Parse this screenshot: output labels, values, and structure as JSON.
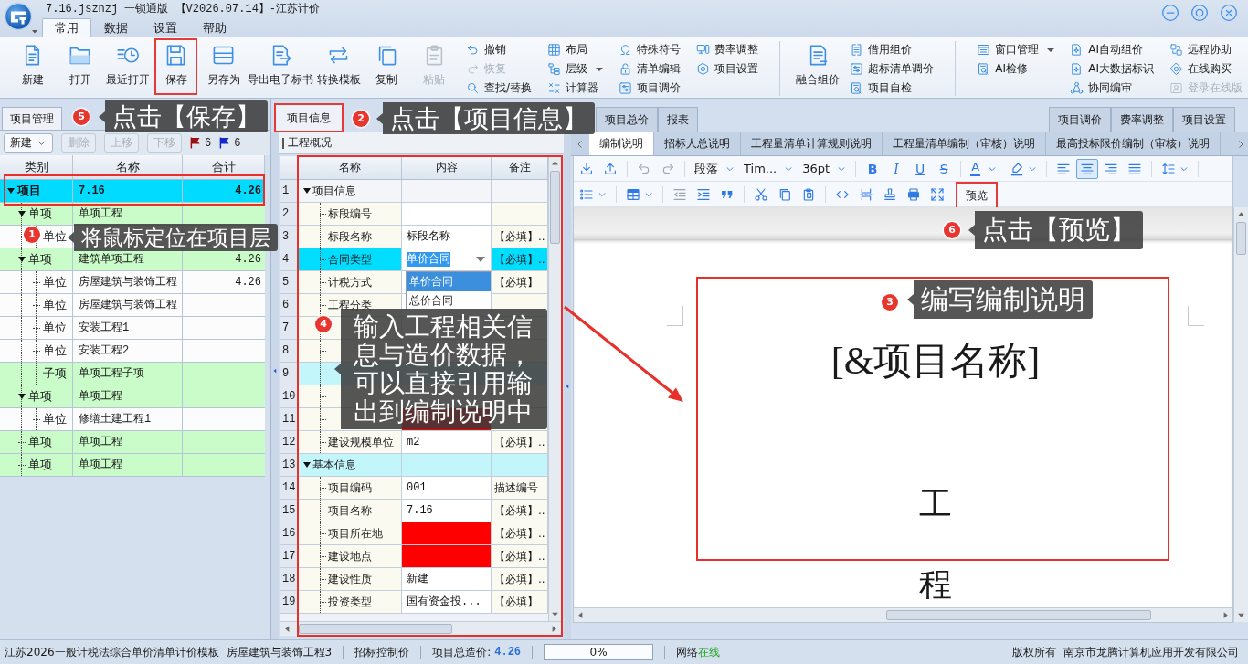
{
  "window": {
    "title": "7.16.jsznzj 一锁通版 【V2026.07.14】-江苏计价"
  },
  "menu_tabs": [
    {
      "label": "常用",
      "selected": true
    },
    {
      "label": "数据",
      "selected": false
    },
    {
      "label": "设置",
      "selected": false
    },
    {
      "label": "帮助",
      "selected": false
    }
  ],
  "ribbon": [
    {
      "kind": "large",
      "label": "新建",
      "disabled": false,
      "marked": false
    },
    {
      "kind": "large",
      "label": "打开",
      "disabled": false,
      "marked": false
    },
    {
      "kind": "large",
      "label": "最近打开",
      "disabled": false,
      "marked": false
    },
    {
      "kind": "large",
      "label": "保存",
      "disabled": false,
      "marked": true
    },
    {
      "kind": "large",
      "label": "另存为",
      "disabled": false,
      "marked": false
    },
    {
      "kind": "large",
      "label": "导出电子标书",
      "disabled": false,
      "marked": false
    },
    {
      "kind": "large",
      "label": "转换模板",
      "disabled": false,
      "marked": false
    },
    {
      "kind": "large",
      "label": "复制",
      "disabled": false,
      "marked": false
    },
    {
      "kind": "large",
      "label": "粘贴",
      "disabled": true,
      "marked": false
    },
    {
      "kind": "stack",
      "buttons": [
        {
          "label": "撤销",
          "disabled": false,
          "has_menu": false
        },
        {
          "label": "恢复",
          "disabled": true,
          "has_menu": false
        },
        {
          "label": "查找/替换",
          "disabled": false,
          "has_menu": false
        }
      ]
    },
    {
      "kind": "stack",
      "buttons": [
        {
          "label": "布局",
          "disabled": false,
          "has_menu": false
        },
        {
          "label": "层级",
          "disabled": false,
          "has_menu": true
        },
        {
          "label": "计算器",
          "disabled": false,
          "has_menu": false
        }
      ]
    },
    {
      "kind": "stack",
      "buttons": [
        {
          "label": "特殊符号",
          "disabled": false,
          "has_menu": false
        },
        {
          "label": "清单编辑",
          "disabled": false,
          "has_menu": false
        },
        {
          "label": "项目调价",
          "disabled": false,
          "has_menu": false
        }
      ]
    },
    {
      "kind": "stack",
      "buttons": [
        {
          "label": "费率调整",
          "disabled": false,
          "has_menu": false
        },
        {
          "label": "项目设置",
          "disabled": false,
          "has_menu": false
        }
      ]
    },
    {
      "kind": "separator"
    },
    {
      "kind": "large",
      "label": "融合组价",
      "disabled": false,
      "marked": false
    },
    {
      "kind": "stack",
      "buttons": [
        {
          "label": "借用组价",
          "disabled": false,
          "has_menu": false
        },
        {
          "label": "超标清单调价",
          "disabled": false,
          "has_menu": false
        },
        {
          "label": "项目自检",
          "disabled": false,
          "has_menu": false
        }
      ]
    },
    {
      "kind": "separator"
    },
    {
      "kind": "stack",
      "buttons": [
        {
          "label": "窗口管理",
          "disabled": false,
          "has_menu": true
        },
        {
          "label": "AI检修",
          "disabled": false,
          "has_menu": false
        }
      ]
    },
    {
      "kind": "stack",
      "buttons": [
        {
          "label": "AI自动组价",
          "disabled": false,
          "has_menu": false
        },
        {
          "label": "AI大数据标识",
          "disabled": false,
          "has_menu": false
        },
        {
          "label": "协同编审",
          "disabled": false,
          "has_menu": false
        }
      ]
    },
    {
      "kind": "stack",
      "buttons": [
        {
          "label": "远程协助",
          "disabled": false,
          "has_menu": false
        },
        {
          "label": "在线购买",
          "disabled": false,
          "has_menu": false
        },
        {
          "label": "登录在线版",
          "disabled": true,
          "has_menu": false
        }
      ]
    }
  ],
  "project_panel": {
    "tab": "项目管理",
    "toolbar": [
      {
        "label": "新建",
        "disabled": false,
        "has_menu": true
      },
      {
        "label": "删除",
        "disabled": true,
        "has_menu": false
      },
      {
        "label": "上移",
        "disabled": true,
        "has_menu": false
      },
      {
        "label": "下移",
        "disabled": true,
        "has_menu": false
      }
    ],
    "flags": [
      {
        "count": "6",
        "color": "#9c1010"
      },
      {
        "count": "6",
        "color": "#1428c8"
      }
    ],
    "columns": [
      "类别",
      "名称",
      "合计"
    ],
    "tree": [
      {
        "kind": "project",
        "category": "项目",
        "name": "7.16",
        "total": "4.26",
        "selected": true,
        "expanded": true,
        "marked": true,
        "children": [
          {
            "kind": "item",
            "category": "单项",
            "name": "单项工程",
            "selected": false,
            "expanded": true,
            "children": [
              {
                "kind": "unit",
                "category": "单位",
                "selected": false,
                "expanded": false
              }
            ]
          },
          {
            "kind": "item",
            "category": "单项",
            "name": "建筑单项工程",
            "total": "4.26",
            "selected": false,
            "expanded": true,
            "children": [
              {
                "kind": "unit",
                "category": "单位",
                "name": "房屋建筑与装饰工程",
                "total": "4.26",
                "selected": false,
                "expanded": false
              },
              {
                "kind": "unit",
                "category": "单位",
                "name": "房屋建筑与装饰工程",
                "selected": false,
                "expanded": false
              },
              {
                "kind": "unit",
                "category": "单位",
                "name": "安装工程1",
                "selected": false,
                "expanded": false
              },
              {
                "kind": "unit",
                "category": "单位",
                "name": "安装工程2",
                "selected": false,
                "expanded": false
              },
              {
                "kind": "subitem",
                "category": "子项",
                "name": "单项工程子项",
                "selected": false,
                "expanded": false
              }
            ]
          },
          {
            "kind": "item",
            "category": "单项",
            "name": "单项工程",
            "selected": false,
            "expanded": true,
            "children": [
              {
                "kind": "unit",
                "category": "单位",
                "name": "修缮土建工程1",
                "selected": false,
                "expanded": false
              }
            ]
          },
          {
            "kind": "item",
            "category": "单项",
            "name": "单项工程",
            "selected": false,
            "expanded": false
          },
          {
            "kind": "item",
            "category": "单项",
            "name": "单项工程",
            "selected": false,
            "expanded": false
          }
        ]
      }
    ]
  },
  "module_tabs": {
    "left": [
      {
        "label": "项目信息",
        "selected": true,
        "marked": true
      },
      {
        "label": "项目总价",
        "selected": false,
        "marked": false
      },
      {
        "label": "报表",
        "selected": false,
        "marked": false
      }
    ],
    "right": [
      {
        "label": "项目调价",
        "selected": false
      },
      {
        "label": "费率调整",
        "selected": false
      },
      {
        "label": "项目设置",
        "selected": false
      }
    ]
  },
  "overview": {
    "title": "工程概况",
    "marked": true,
    "columns": [
      "名称",
      "内容",
      "备注"
    ],
    "rows": [
      {
        "kind": "group",
        "number": "1",
        "name": "项目信息",
        "selected": false,
        "expanded": true,
        "children": [
          {
            "kind": "field",
            "number": "2",
            "name": "标段编号",
            "selected": false,
            "missing": false
          },
          {
            "kind": "field",
            "number": "3",
            "name": "标段名称",
            "value": "标段名称",
            "note": "【必填】..",
            "selected": false,
            "missing": false
          },
          {
            "kind": "field",
            "number": "4",
            "name": "合同类型",
            "value": "单价合同",
            "note": "【必填】..",
            "selected": true,
            "missing": false,
            "options": [
              {
                "label": "单价合同",
                "selected": true
              },
              {
                "label": "总价合同",
                "selected": false
              }
            ]
          },
          {
            "kind": "field",
            "number": "5",
            "name": "计税方式",
            "note": "【必填】",
            "selected": false,
            "missing": false
          },
          {
            "kind": "field",
            "number": "6",
            "name": "工程分类",
            "selected": false,
            "missing": false
          },
          {
            "kind": "field",
            "number": "7",
            "selected": false,
            "missing": false
          },
          {
            "kind": "field",
            "number": "8",
            "selected": false,
            "missing": false
          },
          {
            "kind": "field",
            "number": "9",
            "selected": false,
            "missing": false,
            "color": "#c2f6fb"
          },
          {
            "kind": "field",
            "number": "10",
            "selected": false,
            "missing": false
          },
          {
            "kind": "field",
            "number": "11",
            "selected": false,
            "missing": true
          },
          {
            "kind": "field",
            "number": "12",
            "name": "建设规模单位",
            "value": "m2",
            "note": "【必填】..",
            "selected": false,
            "missing": false
          }
        ]
      },
      {
        "kind": "group",
        "number": "13",
        "name": "基本信息",
        "selected": false,
        "expanded": true,
        "color": "#c2f6fb",
        "children": [
          {
            "kind": "field",
            "number": "14",
            "name": "项目编码",
            "value": "001",
            "note": "描述编号",
            "selected": false,
            "missing": false
          },
          {
            "kind": "field",
            "number": "15",
            "name": "项目名称",
            "value": "7.16",
            "note": "【必填】..",
            "selected": false,
            "missing": false
          },
          {
            "kind": "field",
            "number": "16",
            "name": "项目所在地",
            "note": "【必填】..",
            "selected": false,
            "missing": true
          },
          {
            "kind": "field",
            "number": "17",
            "name": "建设地点",
            "note": "【必填】..",
            "selected": false,
            "missing": true
          },
          {
            "kind": "field",
            "number": "18",
            "name": "建设性质",
            "value": "新建",
            "note": "【必填】..",
            "selected": false,
            "missing": false
          },
          {
            "kind": "field",
            "number": "19",
            "name": "投资类型",
            "value": "国有资金投...",
            "note": "【必填】",
            "selected": false,
            "missing": false
          }
        ]
      }
    ]
  },
  "document_tabs": [
    {
      "label": "编制说明",
      "selected": true
    },
    {
      "label": "招标人总说明",
      "selected": false
    },
    {
      "label": "工程量清单计算规则说明",
      "selected": false
    },
    {
      "label": "工程量清单编制（审核）说明",
      "selected": false
    },
    {
      "label": "最高投标限价编制（审核）说明",
      "selected": false
    }
  ],
  "editor": {
    "undo": {
      "disabled": true
    },
    "redo": {
      "disabled": true
    },
    "outdent": {
      "disabled": true
    },
    "block_format": "段落",
    "font": "Tim...",
    "size": "36pt",
    "text_styles": [
      {
        "kind": "bold",
        "label": "B"
      },
      {
        "kind": "italic",
        "label": "I"
      },
      {
        "kind": "underline",
        "label": "U"
      },
      {
        "kind": "strike",
        "label": "S"
      }
    ],
    "font_color_label": "A",
    "alignments": [
      {
        "selected": false
      },
      {
        "selected": true
      },
      {
        "selected": false
      },
      {
        "selected": false
      }
    ],
    "preview": {
      "label": "预览",
      "marked": true
    },
    "page": {
      "heading": "[&项目名称]",
      "lines": [
        "工",
        "程"
      ],
      "marked": true
    }
  },
  "annotations": [
    {
      "number": "1",
      "text": "将鼠标定位在项目层"
    },
    {
      "number": "2",
      "text": "点击【项目信息】"
    },
    {
      "number": "3",
      "text": "编写编制说明"
    },
    {
      "number": "4",
      "text": "输入工程相关信息与造价数据，可以直接引用输出到编制说明中"
    },
    {
      "number": "5",
      "text": "点击【保存】"
    },
    {
      "number": "6",
      "text": "点击【预览】"
    }
  ],
  "status_bar": {
    "template": "江苏2026一般计税法综合单价清单计价模板",
    "unit": "房屋建筑与装饰工程3",
    "price_type": "招标控制价",
    "total_label": "项目总造价:",
    "total": "4.26",
    "progress": {
      "level": 0,
      "reading": "0%"
    },
    "network_label": "网络",
    "network_status": "在线",
    "copyright": "版权所有",
    "company": "南京市龙腾计算机应用开发有限公司"
  }
}
